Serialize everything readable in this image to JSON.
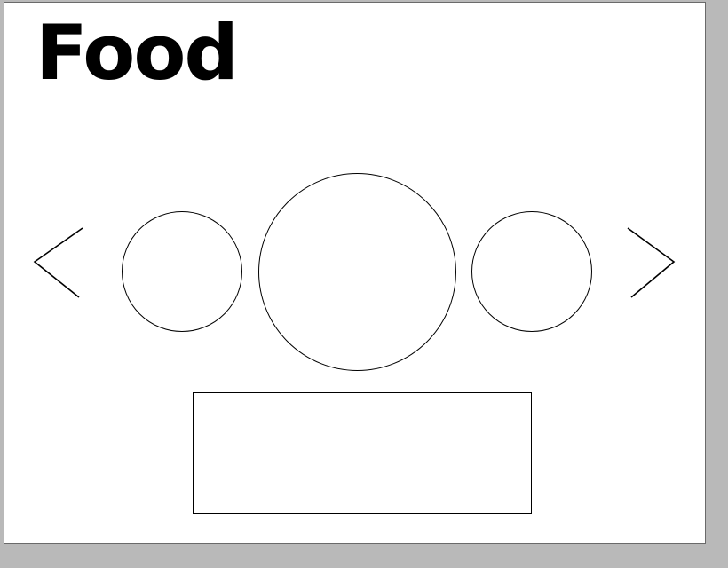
{
  "page": {
    "title": "Food"
  },
  "carousel": {
    "prev_icon": "chevron-left-icon",
    "next_icon": "chevron-right-icon",
    "items": [
      {
        "label": ""
      },
      {
        "label": ""
      },
      {
        "label": ""
      }
    ]
  },
  "caption": {
    "text": ""
  },
  "colors": {
    "background": "#b9b9b9",
    "canvas": "#ffffff",
    "stroke": "#000000"
  }
}
